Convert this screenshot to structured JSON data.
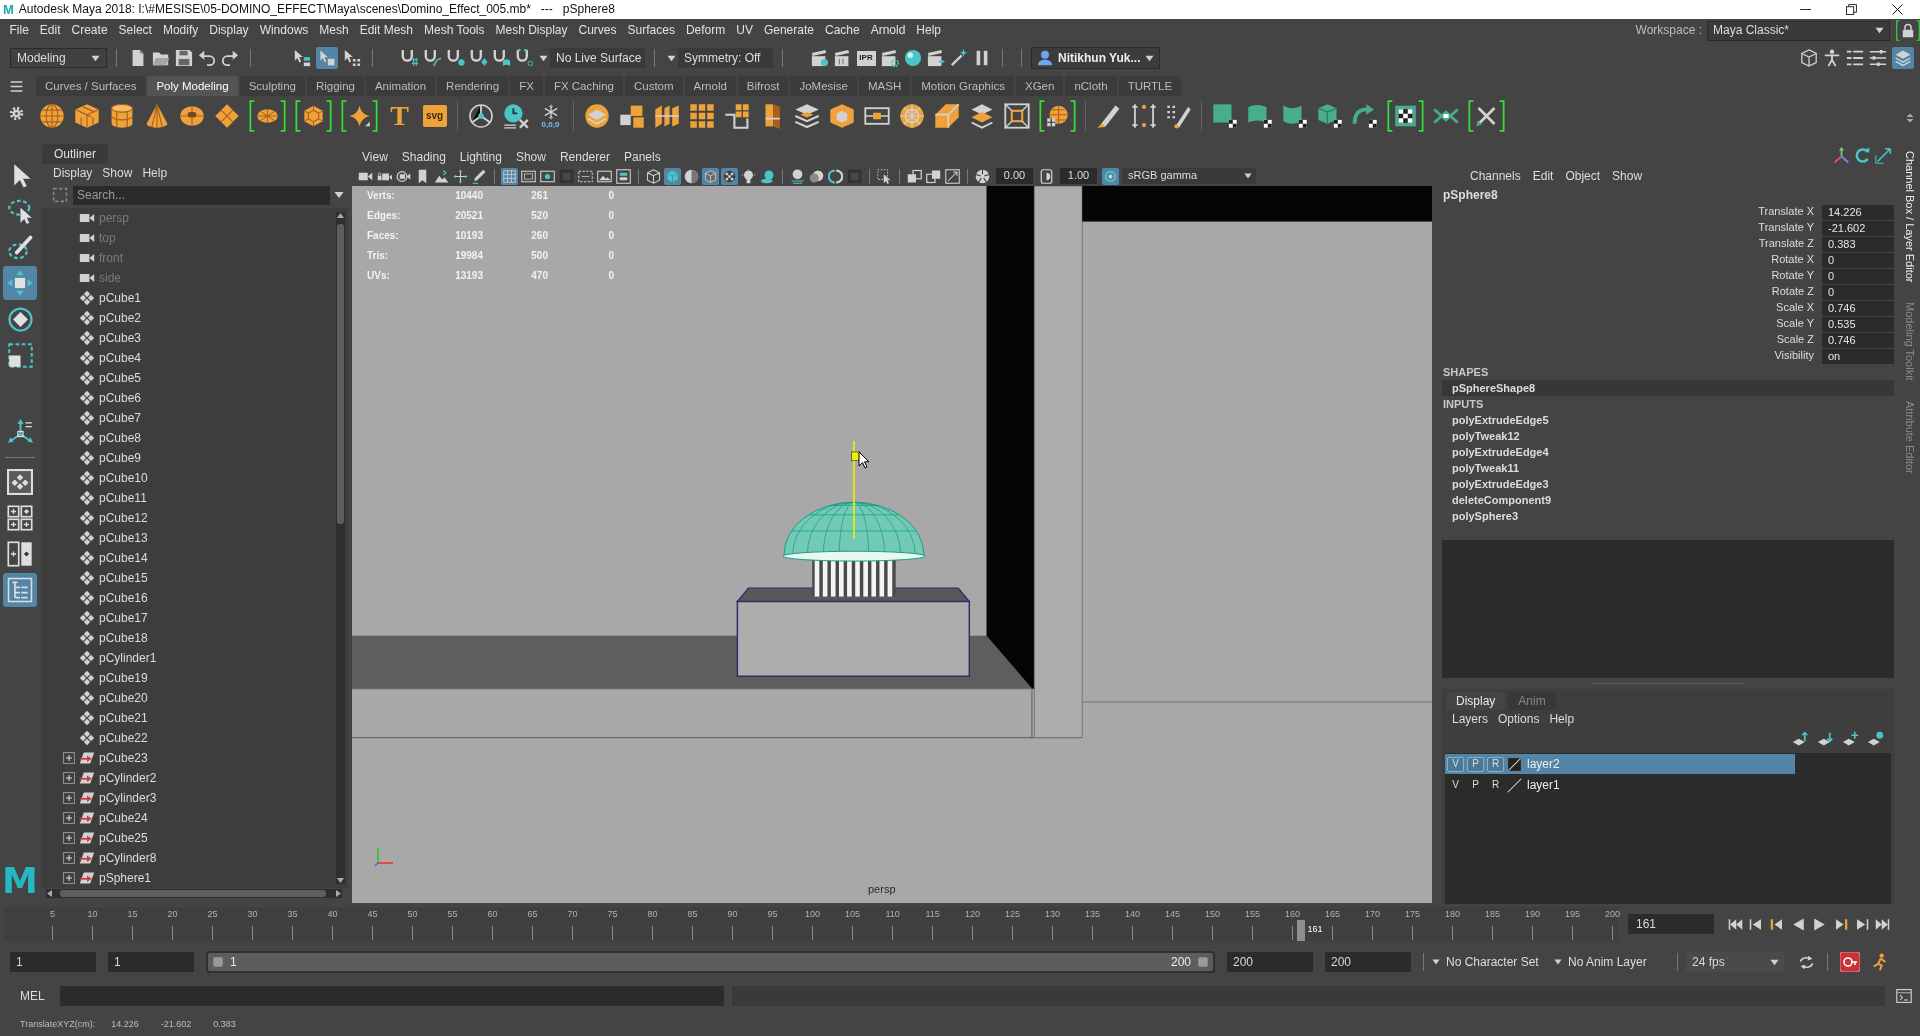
{
  "window": {
    "logo": "M",
    "title": "Autodesk Maya 2018: I:\\#MESISE\\05-DOMINO_EFFECT\\Maya\\scenes\\Domino_Effect_005.mb*   ---   pSphere8"
  },
  "menu_bar": {
    "items": [
      "File",
      "Edit",
      "Create",
      "Select",
      "Modify",
      "Display",
      "Windows",
      "Mesh",
      "Edit Mesh",
      "Mesh Tools",
      "Mesh Display",
      "Curves",
      "Surfaces",
      "Deform",
      "UV",
      "Generate",
      "Cache",
      "Arnold",
      "Help"
    ],
    "workspace_label": "Workspace :",
    "workspace": "Maya Classic*",
    "workspace_lock": {
      "highlighted": true
    }
  },
  "status_line": {
    "menu_set": "Modeling",
    "selection_modes": [
      {
        "selected": false
      },
      {
        "selected": true
      },
      {
        "selected": false
      }
    ],
    "live_surface": "No Live Surface",
    "symmetry": "Symmetry: Off",
    "ipr": "IPR",
    "user": "Nitikhun Yuk...",
    "panel_toggles": [
      {
        "selected": false
      },
      {
        "selected": false
      },
      {
        "selected": false
      },
      {
        "selected": false
      },
      {
        "selected": true
      }
    ]
  },
  "shelf": {
    "tabs": [
      {
        "label": "Curves / Surfaces",
        "selected": false
      },
      {
        "label": "Poly Modeling",
        "selected": true
      },
      {
        "label": "Sculpting",
        "selected": false
      },
      {
        "label": "Rigging",
        "selected": false
      },
      {
        "label": "Animation",
        "selected": false
      },
      {
        "label": "Rendering",
        "selected": false
      },
      {
        "label": "FX",
        "selected": false
      },
      {
        "label": "FX Caching",
        "selected": false
      },
      {
        "label": "Custom",
        "selected": false
      },
      {
        "label": "Arnold",
        "selected": false
      },
      {
        "label": "Bifrost",
        "selected": false
      },
      {
        "label": "JoMesise",
        "selected": false
      },
      {
        "label": "MASH",
        "selected": false
      },
      {
        "label": "Motion Graphics",
        "selected": false
      },
      {
        "label": "XGen",
        "selected": false
      },
      {
        "label": "nCloth",
        "selected": false
      },
      {
        "label": "TURTLE",
        "selected": false
      }
    ],
    "groups": [
      [
        {
          "highlighted": false
        },
        {
          "highlighted": false
        },
        {
          "highlighted": false
        },
        {
          "highlighted": false
        },
        {
          "highlighted": false
        },
        {
          "highlighted": false
        },
        {
          "highlighted": true
        },
        {
          "highlighted": true
        },
        {
          "highlighted": true
        },
        {
          "text": "T",
          "highlighted": false
        },
        {
          "text": "svg",
          "highlighted": false
        }
      ],
      [
        {
          "highlighted": false
        },
        {
          "highlighted": false
        },
        {
          "text": "0,0,0",
          "highlighted": false
        }
      ],
      [
        {
          "highlighted": false
        },
        {
          "highlighted": false
        },
        {
          "highlighted": false
        },
        {
          "highlighted": false
        },
        {
          "highlighted": false
        },
        {
          "highlighted": false
        },
        {
          "highlighted": false
        },
        {
          "highlighted": false
        },
        {
          "highlighted": false
        },
        {
          "highlighted": false
        },
        {
          "highlighted": false
        },
        {
          "highlighted": false
        },
        {
          "highlighted": false
        },
        {
          "highlighted": true
        }
      ],
      [
        {
          "highlighted": false
        },
        {
          "highlighted": false
        },
        {
          "highlighted": false
        }
      ],
      [
        {
          "highlighted": false
        },
        {
          "highlighted": false
        },
        {
          "highlighted": false
        },
        {
          "highlighted": false
        },
        {
          "highlighted": false
        },
        {
          "highlighted": true
        },
        {
          "highlighted": false
        },
        {
          "highlighted": true
        }
      ]
    ]
  },
  "toolbox": {
    "tools": [
      {
        "selected": false
      },
      {
        "selected": false
      },
      {
        "selected": false
      },
      {
        "selected": true
      },
      {
        "selected": false
      },
      {
        "selected": false
      },
      {
        "selected": false
      }
    ],
    "layouts": [
      {
        "selected": false
      },
      {
        "selected": false
      },
      {
        "selected": false
      },
      {
        "selected": true
      }
    ],
    "logo": "M"
  },
  "outliner": {
    "title": "Outliner",
    "menu": [
      "Display",
      "Show",
      "Help"
    ],
    "search": {
      "placeholder": "Search..."
    },
    "items": [
      {
        "label": "persp",
        "kind": "camera",
        "hidden": true
      },
      {
        "label": "top",
        "kind": "camera",
        "hidden": true
      },
      {
        "label": "front",
        "kind": "camera",
        "hidden": true
      },
      {
        "label": "side",
        "kind": "camera",
        "hidden": true
      },
      {
        "label": "pCube1",
        "kind": "mesh",
        "hidden": false
      },
      {
        "label": "pCube2",
        "kind": "mesh",
        "hidden": false
      },
      {
        "label": "pCube3",
        "kind": "mesh",
        "hidden": false
      },
      {
        "label": "pCube4",
        "kind": "mesh",
        "hidden": false
      },
      {
        "label": "pCube5",
        "kind": "mesh",
        "hidden": false
      },
      {
        "label": "pCube6",
        "kind": "mesh",
        "hidden": false
      },
      {
        "label": "pCube7",
        "kind": "mesh",
        "hidden": false
      },
      {
        "label": "pCube8",
        "kind": "mesh",
        "hidden": false
      },
      {
        "label": "pCube9",
        "kind": "mesh",
        "hidden": false
      },
      {
        "label": "pCube10",
        "kind": "mesh",
        "hidden": false
      },
      {
        "label": "pCube11",
        "kind": "mesh",
        "hidden": false
      },
      {
        "label": "pCube12",
        "kind": "mesh",
        "hidden": false
      },
      {
        "label": "pCube13",
        "kind": "mesh",
        "hidden": false
      },
      {
        "label": "pCube14",
        "kind": "mesh",
        "hidden": false
      },
      {
        "label": "pCube15",
        "kind": "mesh",
        "hidden": false
      },
      {
        "label": "pCube16",
        "kind": "mesh",
        "hidden": false
      },
      {
        "label": "pCube17",
        "kind": "mesh",
        "hidden": false
      },
      {
        "label": "pCube18",
        "kind": "mesh",
        "hidden": false
      },
      {
        "label": "pCylinder1",
        "kind": "mesh",
        "hidden": false
      },
      {
        "label": "pCube19",
        "kind": "mesh",
        "hidden": false
      },
      {
        "label": "pCube20",
        "kind": "mesh",
        "hidden": false
      },
      {
        "label": "pCube21",
        "kind": "mesh",
        "hidden": false
      },
      {
        "label": "pCube22",
        "kind": "mesh",
        "hidden": false
      },
      {
        "label": "pCube23",
        "kind": "group",
        "hidden": false,
        "expanded": false
      },
      {
        "label": "pCylinder2",
        "kind": "group",
        "hidden": false,
        "expanded": false
      },
      {
        "label": "pCylinder3",
        "kind": "group",
        "hidden": false,
        "expanded": false
      },
      {
        "label": "pCube24",
        "kind": "group",
        "hidden": false,
        "expanded": false
      },
      {
        "label": "pCube25",
        "kind": "group",
        "hidden": false,
        "expanded": false
      },
      {
        "label": "pCylinder8",
        "kind": "group",
        "hidden": false,
        "expanded": false
      },
      {
        "label": "pSphere1",
        "kind": "group",
        "hidden": false,
        "expanded": false
      }
    ]
  },
  "viewport": {
    "menu": [
      "View",
      "Shading",
      "Lighting",
      "Show",
      "Renderer",
      "Panels"
    ],
    "toolbar_groups": [
      [
        {
          "selected": false
        },
        {
          "selected": false
        },
        {
          "selected": false
        },
        {
          "selected": false
        },
        {
          "selected": false
        },
        {
          "selected": false
        },
        {
          "selected": false
        }
      ],
      [
        {
          "selected": true
        },
        {
          "selected": false
        },
        {
          "selected": false
        },
        {
          "selected": false
        },
        {
          "selected": false
        },
        {
          "selected": false
        },
        {
          "selected": false
        }
      ],
      [
        {
          "selected": false
        },
        {
          "selected": true
        },
        {
          "selected": false
        },
        {
          "selected": true
        },
        {
          "selected": true
        },
        {
          "selected": false
        },
        {
          "selected": false
        }
      ],
      [
        {
          "selected": false
        },
        {
          "selected": false
        },
        {
          "selected": false
        },
        {
          "selected": false
        }
      ],
      [
        {
          "selected": false
        }
      ],
      [
        {
          "selected": false
        },
        {
          "selected": false
        },
        {
          "selected": false
        }
      ]
    ],
    "exposure": "0.00",
    "gamma": "1.00",
    "color_management": {
      "selected": true
    },
    "view_transform": "sRGB gamma",
    "hud": [
      {
        "label": "Verts:",
        "values": [
          "10440",
          "261",
          "0"
        ]
      },
      {
        "label": "Edges:",
        "values": [
          "20521",
          "520",
          "0"
        ]
      },
      {
        "label": "Faces:",
        "values": [
          "10193",
          "260",
          "0"
        ]
      },
      {
        "label": "Tris:",
        "values": [
          "19984",
          "500",
          "0"
        ]
      },
      {
        "label": "UVs:",
        "values": [
          "13193",
          "470",
          "0"
        ]
      }
    ],
    "camera": "persp"
  },
  "channel_box": {
    "menu": [
      "Channels",
      "Edit",
      "Object",
      "Show"
    ],
    "object": "pSphere8",
    "attributes": [
      {
        "name": "Translate X",
        "value": "14.226"
      },
      {
        "name": "Translate Y",
        "value": "-21.602"
      },
      {
        "name": "Translate Z",
        "value": "0.383"
      },
      {
        "name": "Rotate X",
        "value": "0"
      },
      {
        "name": "Rotate Y",
        "value": "0"
      },
      {
        "name": "Rotate Z",
        "value": "0"
      },
      {
        "name": "Scale X",
        "value": "0.746"
      },
      {
        "name": "Scale Y",
        "value": "0.535"
      },
      {
        "name": "Scale Z",
        "value": "0.746"
      },
      {
        "name": "Visibility",
        "value": "on"
      }
    ],
    "shapes_heading": "SHAPES",
    "shapes": [
      "pSphereShape8"
    ],
    "inputs_heading": "INPUTS",
    "inputs": [
      "polyExtrudeEdge5",
      "polyTweak12",
      "polyExtrudeEdge4",
      "polyTweak11",
      "polyExtrudeEdge3",
      "deleteComponent9",
      "polySphere3"
    ]
  },
  "layer_editor": {
    "tabs": [
      {
        "label": "Display",
        "selected": true
      },
      {
        "label": "Anim",
        "selected": false
      }
    ],
    "menu": [
      "Layers",
      "Options",
      "Help"
    ],
    "layers": [
      {
        "name": "layer2",
        "selected": true,
        "toggles": [
          "V",
          "P",
          "R"
        ]
      },
      {
        "name": "layer1",
        "selected": false,
        "toggles": [
          "V",
          "P",
          "R"
        ]
      }
    ]
  },
  "side_tabs": [
    {
      "label": "Channel Box / Layer Editor",
      "selected": true
    },
    {
      "label": "Modeling Toolkit",
      "selected": false
    },
    {
      "label": "Attribute Editor",
      "selected": false
    }
  ],
  "time_slider": {
    "ticks": [
      "5",
      "10",
      "15",
      "20",
      "25",
      "30",
      "35",
      "40",
      "45",
      "50",
      "55",
      "60",
      "65",
      "70",
      "75",
      "80",
      "85",
      "90",
      "95",
      "100",
      "105",
      "110",
      "115",
      "120",
      "125",
      "130",
      "135",
      "140",
      "145",
      "150",
      "155",
      "160",
      "165",
      "170",
      "175",
      "180",
      "185",
      "190",
      "195",
      "200"
    ],
    "level": 0.805,
    "current_frame": "161",
    "current_time": "161"
  },
  "range_slider": {
    "animation_start": "1",
    "playback_start": "1",
    "level": 1,
    "range_start": "1",
    "range_end": "200",
    "playback_end": "200",
    "animation_end": "200",
    "character_set": "No Character Set",
    "anim_layer": "No Anim Layer",
    "fps": "24 fps",
    "auto_key": true
  },
  "command_line": {
    "language": "MEL"
  },
  "help_line": {
    "label": "TranslateXYZ(cm):",
    "values": [
      "14.226",
      "-21.602",
      "0.383"
    ]
  }
}
